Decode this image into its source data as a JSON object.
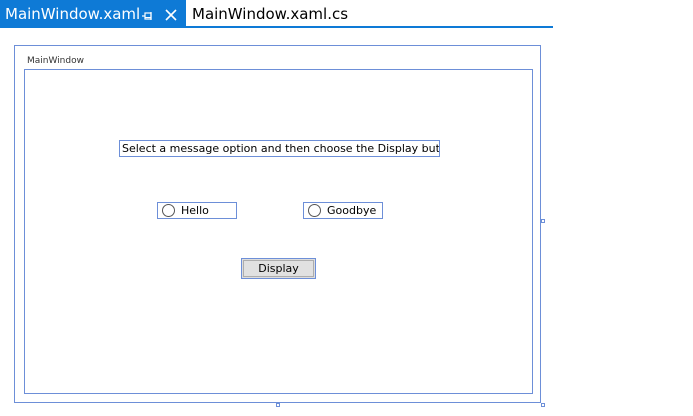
{
  "tabs": [
    {
      "label": "MainWindow.xaml",
      "active": true,
      "pin_icon": "pin-icon",
      "close_icon": "close-icon"
    },
    {
      "label": "MainWindow.xaml.cs",
      "active": false
    }
  ],
  "designer": {
    "window_title": "MainWindow",
    "instruction_text": "Select a message option and then choose the Display button.",
    "radio_buttons": [
      {
        "label": "Hello",
        "checked": false
      },
      {
        "label": "Goodbye",
        "checked": false
      }
    ],
    "display_button_label": "Display"
  },
  "colors": {
    "tab_accent": "#0e7ad6",
    "selection_border": "#6d8fd8",
    "button_face": "#e1e1e1"
  }
}
